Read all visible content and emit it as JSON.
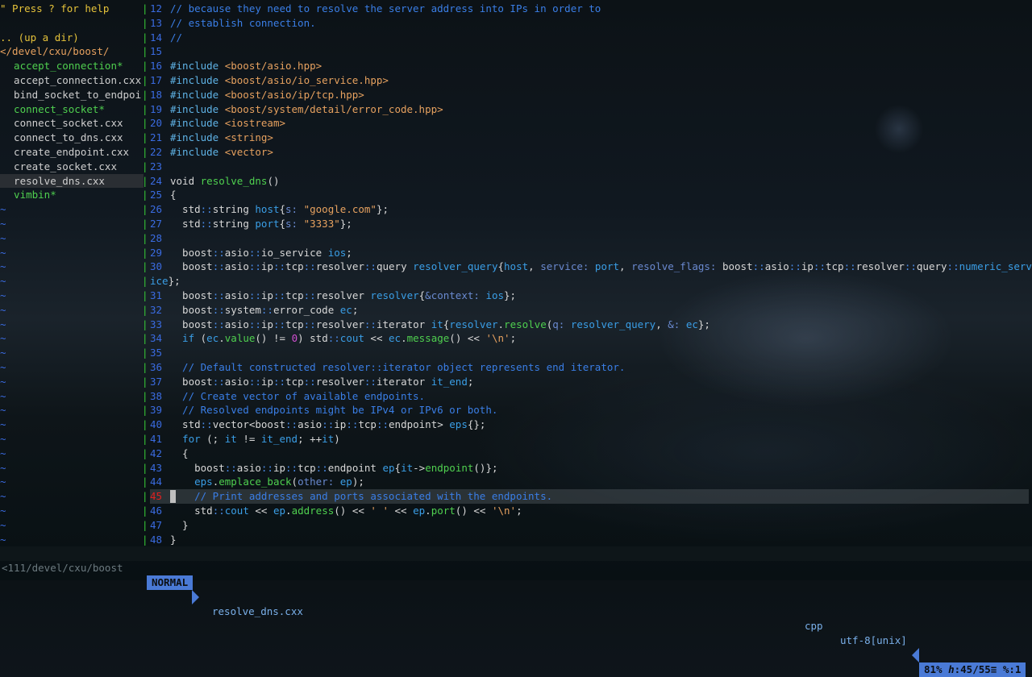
{
  "tree": {
    "help": "\" Press ? for help",
    "up_dir": ".. (up a dir)",
    "cwd": "</devel/cxu/boost/",
    "entries": [
      {
        "name": "accept_connection*",
        "kind": "exec"
      },
      {
        "name": "accept_connection.cxx",
        "kind": "file"
      },
      {
        "name": "bind_socket_to_endpoi",
        "kind": "file"
      },
      {
        "name": "connect_socket*",
        "kind": "exec"
      },
      {
        "name": "connect_socket.cxx",
        "kind": "file"
      },
      {
        "name": "connect_to_dns.cxx",
        "kind": "file"
      },
      {
        "name": "create_endpoint.cxx",
        "kind": "file"
      },
      {
        "name": "create_socket.cxx",
        "kind": "file"
      },
      {
        "name": "resolve_dns.cxx",
        "kind": "file",
        "selected": true
      },
      {
        "name": "vimbin*",
        "kind": "exec"
      }
    ],
    "tilde": "~"
  },
  "editor": {
    "lines": [
      {
        "n": "12",
        "segs": [
          [
            "c-comment",
            "// because they need to resolve the server address into IPs in order to"
          ]
        ]
      },
      {
        "n": "13",
        "segs": [
          [
            "c-comment",
            "// establish connection."
          ]
        ]
      },
      {
        "n": "14",
        "segs": [
          [
            "c-comment",
            "//"
          ]
        ]
      },
      {
        "n": "15",
        "segs": []
      },
      {
        "n": "16",
        "segs": [
          [
            "c-inc",
            "#include "
          ],
          [
            "c-str",
            "<boost/asio.hpp>"
          ]
        ]
      },
      {
        "n": "17",
        "segs": [
          [
            "c-inc",
            "#include "
          ],
          [
            "c-str",
            "<boost/asio/io_service.hpp>"
          ]
        ]
      },
      {
        "n": "18",
        "segs": [
          [
            "c-inc",
            "#include "
          ],
          [
            "c-str",
            "<boost/asio/ip/tcp.hpp>"
          ]
        ]
      },
      {
        "n": "19",
        "segs": [
          [
            "c-inc",
            "#include "
          ],
          [
            "c-str",
            "<boost/system/detail/error_code.hpp>"
          ]
        ]
      },
      {
        "n": "20",
        "segs": [
          [
            "c-inc",
            "#include "
          ],
          [
            "c-str",
            "<iostream>"
          ]
        ]
      },
      {
        "n": "21",
        "segs": [
          [
            "c-inc",
            "#include "
          ],
          [
            "c-str",
            "<string>"
          ]
        ]
      },
      {
        "n": "22",
        "segs": [
          [
            "c-inc",
            "#include "
          ],
          [
            "c-str",
            "<vector>"
          ]
        ]
      },
      {
        "n": "23",
        "segs": []
      },
      {
        "n": "24",
        "segs": [
          [
            "c-ty",
            "void "
          ],
          [
            "c-fn",
            "resolve_dns"
          ],
          [
            "c-ty",
            "()"
          ]
        ]
      },
      {
        "n": "25",
        "segs": [
          [
            "c-ty",
            "{"
          ]
        ]
      },
      {
        "n": "26",
        "segs": [
          [
            "c-ty",
            "  std"
          ],
          [
            "c-ns",
            "::"
          ],
          [
            "c-ty",
            "string "
          ],
          [
            "c-var",
            "host"
          ],
          [
            "c-ty",
            "{"
          ],
          [
            "c-hint",
            "s: "
          ],
          [
            "c-str",
            "\"google.com\""
          ],
          [
            "c-ty",
            "};"
          ]
        ]
      },
      {
        "n": "27",
        "segs": [
          [
            "c-ty",
            "  std"
          ],
          [
            "c-ns",
            "::"
          ],
          [
            "c-ty",
            "string "
          ],
          [
            "c-var",
            "port"
          ],
          [
            "c-ty",
            "{"
          ],
          [
            "c-hint",
            "s: "
          ],
          [
            "c-str",
            "\"3333\""
          ],
          [
            "c-ty",
            "};"
          ]
        ]
      },
      {
        "n": "28",
        "segs": []
      },
      {
        "n": "29",
        "segs": [
          [
            "c-ty",
            "  boost"
          ],
          [
            "c-ns",
            "::"
          ],
          [
            "c-ty",
            "asio"
          ],
          [
            "c-ns",
            "::"
          ],
          [
            "c-ty",
            "io_service "
          ],
          [
            "c-var",
            "ios"
          ],
          [
            "c-ty",
            ";"
          ]
        ]
      },
      {
        "n": "30",
        "segs": [
          [
            "c-ty",
            "  boost"
          ],
          [
            "c-ns",
            "::"
          ],
          [
            "c-ty",
            "asio"
          ],
          [
            "c-ns",
            "::"
          ],
          [
            "c-ty",
            "ip"
          ],
          [
            "c-ns",
            "::"
          ],
          [
            "c-ty",
            "tcp"
          ],
          [
            "c-ns",
            "::"
          ],
          [
            "c-ty",
            "resolver"
          ],
          [
            "c-ns",
            "::"
          ],
          [
            "c-ty",
            "query "
          ],
          [
            "c-var",
            "resolver_query"
          ],
          [
            "c-ty",
            "{"
          ],
          [
            "c-var",
            "host"
          ],
          [
            "c-ty",
            ", "
          ],
          [
            "c-hint",
            "service: "
          ],
          [
            "c-var",
            "port"
          ],
          [
            "c-ty",
            ", "
          ],
          [
            "c-hint",
            "resolve_flags: "
          ],
          [
            "c-ty",
            "boost"
          ],
          [
            "c-ns",
            "::"
          ],
          [
            "c-ty",
            "asio"
          ],
          [
            "c-ns",
            "::"
          ],
          [
            "c-ty",
            "ip"
          ],
          [
            "c-ns",
            "::"
          ],
          [
            "c-ty",
            "tcp"
          ],
          [
            "c-ns",
            "::"
          ],
          [
            "c-ty",
            "resolver"
          ],
          [
            "c-ns",
            "::"
          ],
          [
            "c-ty",
            "query"
          ],
          [
            "c-ns",
            "::"
          ],
          [
            "c-var",
            "numeric_serv"
          ]
        ]
      },
      {
        "n": "",
        "segs": [
          [
            "c-var",
            "ice"
          ],
          [
            "c-ty",
            "};"
          ]
        ],
        "wrap": true
      },
      {
        "n": "31",
        "segs": [
          [
            "c-ty",
            "  boost"
          ],
          [
            "c-ns",
            "::"
          ],
          [
            "c-ty",
            "asio"
          ],
          [
            "c-ns",
            "::"
          ],
          [
            "c-ty",
            "ip"
          ],
          [
            "c-ns",
            "::"
          ],
          [
            "c-ty",
            "tcp"
          ],
          [
            "c-ns",
            "::"
          ],
          [
            "c-ty",
            "resolver "
          ],
          [
            "c-var",
            "resolver"
          ],
          [
            "c-ty",
            "{"
          ],
          [
            "c-hint",
            "&context: "
          ],
          [
            "c-var",
            "ios"
          ],
          [
            "c-ty",
            "};"
          ]
        ]
      },
      {
        "n": "32",
        "segs": [
          [
            "c-ty",
            "  boost"
          ],
          [
            "c-ns",
            "::"
          ],
          [
            "c-ty",
            "system"
          ],
          [
            "c-ns",
            "::"
          ],
          [
            "c-ty",
            "error_code "
          ],
          [
            "c-var",
            "ec"
          ],
          [
            "c-ty",
            ";"
          ]
        ]
      },
      {
        "n": "33",
        "segs": [
          [
            "c-ty",
            "  boost"
          ],
          [
            "c-ns",
            "::"
          ],
          [
            "c-ty",
            "asio"
          ],
          [
            "c-ns",
            "::"
          ],
          [
            "c-ty",
            "ip"
          ],
          [
            "c-ns",
            "::"
          ],
          [
            "c-ty",
            "tcp"
          ],
          [
            "c-ns",
            "::"
          ],
          [
            "c-ty",
            "resolver"
          ],
          [
            "c-ns",
            "::"
          ],
          [
            "c-ty",
            "iterator "
          ],
          [
            "c-var",
            "it"
          ],
          [
            "c-ty",
            "{"
          ],
          [
            "c-var",
            "resolver"
          ],
          [
            "c-ty",
            "."
          ],
          [
            "c-fn",
            "resolve"
          ],
          [
            "c-ty",
            "("
          ],
          [
            "c-hint",
            "q: "
          ],
          [
            "c-var",
            "resolver_query"
          ],
          [
            "c-ty",
            ", "
          ],
          [
            "c-hint",
            "&: "
          ],
          [
            "c-var",
            "ec"
          ],
          [
            "c-ty",
            "};"
          ]
        ]
      },
      {
        "n": "34",
        "segs": [
          [
            "c-kw",
            "  if "
          ],
          [
            "c-ty",
            "("
          ],
          [
            "c-var",
            "ec"
          ],
          [
            "c-ty",
            "."
          ],
          [
            "c-fn",
            "value"
          ],
          [
            "c-ty",
            "() != "
          ],
          [
            "c-num",
            "0"
          ],
          [
            "c-ty",
            ") std"
          ],
          [
            "c-ns",
            "::"
          ],
          [
            "c-var",
            "cout"
          ],
          [
            "c-ty",
            " << "
          ],
          [
            "c-var",
            "ec"
          ],
          [
            "c-ty",
            "."
          ],
          [
            "c-fn",
            "message"
          ],
          [
            "c-ty",
            "() << "
          ],
          [
            "c-str",
            "'\\n'"
          ],
          [
            "c-ty",
            ";"
          ]
        ]
      },
      {
        "n": "35",
        "segs": []
      },
      {
        "n": "36",
        "segs": [
          [
            "c-comment",
            "  // Default constructed resolver::iterator object represents end iterator."
          ]
        ]
      },
      {
        "n": "37",
        "segs": [
          [
            "c-ty",
            "  boost"
          ],
          [
            "c-ns",
            "::"
          ],
          [
            "c-ty",
            "asio"
          ],
          [
            "c-ns",
            "::"
          ],
          [
            "c-ty",
            "ip"
          ],
          [
            "c-ns",
            "::"
          ],
          [
            "c-ty",
            "tcp"
          ],
          [
            "c-ns",
            "::"
          ],
          [
            "c-ty",
            "resolver"
          ],
          [
            "c-ns",
            "::"
          ],
          [
            "c-ty",
            "iterator "
          ],
          [
            "c-var",
            "it_end"
          ],
          [
            "c-ty",
            ";"
          ]
        ]
      },
      {
        "n": "38",
        "segs": [
          [
            "c-comment",
            "  // Create vector of available endpoints."
          ]
        ]
      },
      {
        "n": "39",
        "segs": [
          [
            "c-comment",
            "  // Resolved endpoints might be IPv4 or IPv6 or both."
          ]
        ]
      },
      {
        "n": "40",
        "segs": [
          [
            "c-ty",
            "  std"
          ],
          [
            "c-ns",
            "::"
          ],
          [
            "c-ty",
            "vector<boost"
          ],
          [
            "c-ns",
            "::"
          ],
          [
            "c-ty",
            "asio"
          ],
          [
            "c-ns",
            "::"
          ],
          [
            "c-ty",
            "ip"
          ],
          [
            "c-ns",
            "::"
          ],
          [
            "c-ty",
            "tcp"
          ],
          [
            "c-ns",
            "::"
          ],
          [
            "c-ty",
            "endpoint> "
          ],
          [
            "c-var",
            "eps"
          ],
          [
            "c-ty",
            "{};"
          ]
        ]
      },
      {
        "n": "41",
        "segs": [
          [
            "c-kw",
            "  for "
          ],
          [
            "c-ty",
            "(; "
          ],
          [
            "c-var",
            "it"
          ],
          [
            "c-ty",
            " != "
          ],
          [
            "c-var",
            "it_end"
          ],
          [
            "c-ty",
            "; ++"
          ],
          [
            "c-var",
            "it"
          ],
          [
            "c-ty",
            ")"
          ]
        ]
      },
      {
        "n": "42",
        "segs": [
          [
            "c-ty",
            "  {"
          ]
        ]
      },
      {
        "n": "43",
        "segs": [
          [
            "c-ty",
            "    boost"
          ],
          [
            "c-ns",
            "::"
          ],
          [
            "c-ty",
            "asio"
          ],
          [
            "c-ns",
            "::"
          ],
          [
            "c-ty",
            "ip"
          ],
          [
            "c-ns",
            "::"
          ],
          [
            "c-ty",
            "tcp"
          ],
          [
            "c-ns",
            "::"
          ],
          [
            "c-ty",
            "endpoint "
          ],
          [
            "c-var",
            "ep"
          ],
          [
            "c-ty",
            "{"
          ],
          [
            "c-var",
            "it"
          ],
          [
            "c-ty",
            "->"
          ],
          [
            "c-fn",
            "endpoint"
          ],
          [
            "c-ty",
            "()};"
          ]
        ]
      },
      {
        "n": "44",
        "segs": [
          [
            "c-var",
            "    eps"
          ],
          [
            "c-ty",
            "."
          ],
          [
            "c-fn",
            "emplace_back"
          ],
          [
            "c-ty",
            "("
          ],
          [
            "c-hint",
            "other: "
          ],
          [
            "c-var",
            "ep"
          ],
          [
            "c-ty",
            ");"
          ]
        ]
      },
      {
        "n": "45",
        "segs": [
          [
            "c-comment",
            "    // Print addresses and ports associated with the endpoints."
          ]
        ],
        "current": true
      },
      {
        "n": "46",
        "segs": [
          [
            "c-ty",
            "    std"
          ],
          [
            "c-ns",
            "::"
          ],
          [
            "c-var",
            "cout"
          ],
          [
            "c-ty",
            " << "
          ],
          [
            "c-var",
            "ep"
          ],
          [
            "c-ty",
            "."
          ],
          [
            "c-fn",
            "address"
          ],
          [
            "c-ty",
            "() << "
          ],
          [
            "c-str",
            "' '"
          ],
          [
            "c-ty",
            " << "
          ],
          [
            "c-var",
            "ep"
          ],
          [
            "c-ty",
            "."
          ],
          [
            "c-fn",
            "port"
          ],
          [
            "c-ty",
            "() << "
          ],
          [
            "c-str",
            "'\\n'"
          ],
          [
            "c-ty",
            ";"
          ]
        ]
      },
      {
        "n": "47",
        "segs": [
          [
            "c-ty",
            "  }"
          ]
        ]
      },
      {
        "n": "48",
        "segs": [
          [
            "c-ty",
            "}"
          ]
        ]
      }
    ]
  },
  "statusbar": {
    "tree_path": "<111/devel/cxu/boost",
    "mode": "NORMAL",
    "filename": "resolve_dns.cxx",
    "filetype": "cpp",
    "encoding": "utf-8[unix]",
    "position": "81% ℎ:45/55≡ %:1"
  },
  "colors": {
    "accent": "#4a7ad6",
    "separator": "#37c837",
    "line_number": "#3a6be0",
    "current_line_number": "#e02020"
  }
}
